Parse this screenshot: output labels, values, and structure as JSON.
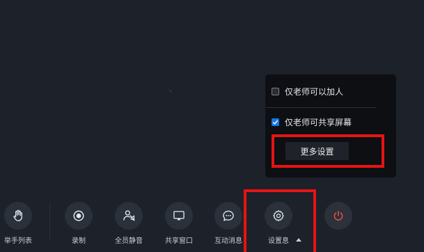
{
  "popup": {
    "options": [
      {
        "label": "仅老师可以加人",
        "checked": false
      },
      {
        "label": "仅老师可共享屏幕",
        "checked": true
      }
    ],
    "more_settings_label": "更多设置"
  },
  "toolbar": {
    "items": [
      {
        "label": "举手列表",
        "icon": "hand-icon"
      },
      {
        "label": "录制",
        "icon": "record-icon"
      },
      {
        "label": "全员静音",
        "icon": "mute-all-icon"
      },
      {
        "label": "共享窗口",
        "icon": "share-window-icon"
      },
      {
        "label": "互动消息",
        "icon": "chat-icon"
      },
      {
        "label": "设置息",
        "icon": "gear-icon"
      },
      {
        "label": "",
        "icon": "power-icon"
      }
    ]
  },
  "colors": {
    "background": "#1c212a",
    "accent": "#1677e8",
    "highlight": "#e81313",
    "power": "#e8533a"
  }
}
